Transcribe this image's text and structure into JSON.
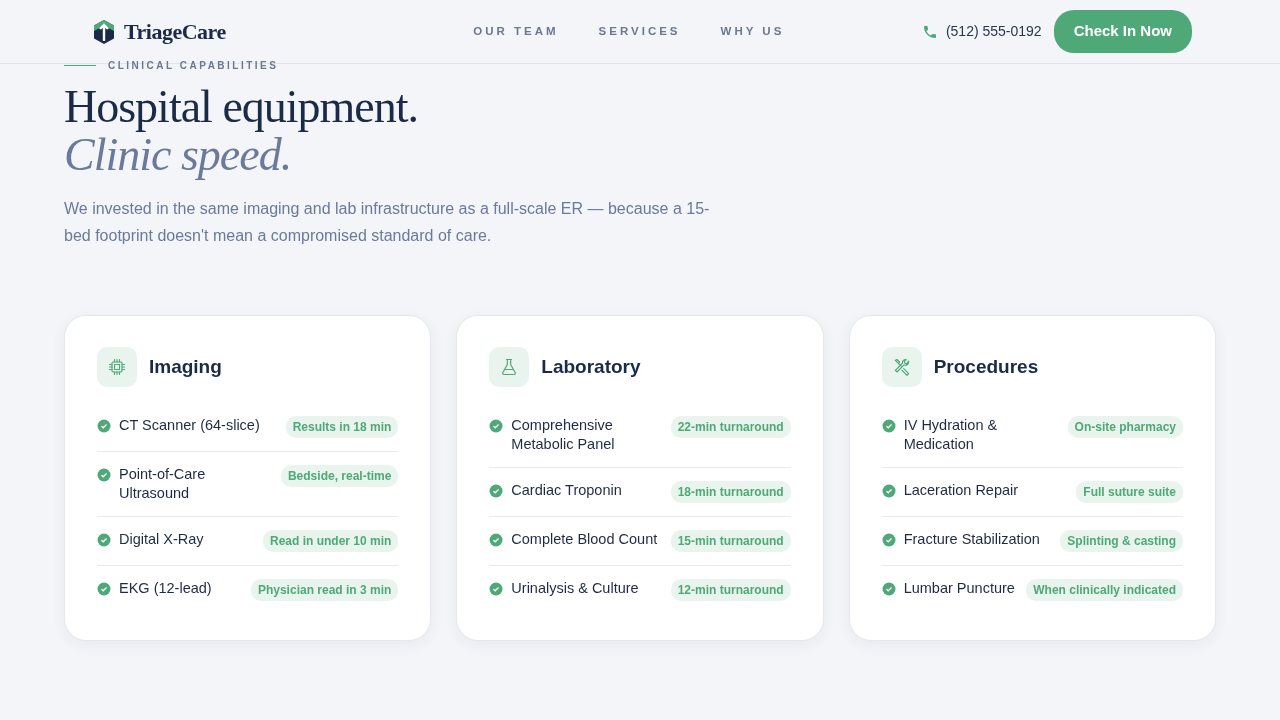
{
  "header": {
    "brand": "TriageCare",
    "nav": [
      {
        "label": "OUR TEAM"
      },
      {
        "label": "SERVICES"
      },
      {
        "label": "WHY US"
      }
    ],
    "phone": "(512) 555-0192",
    "cta": "Check In Now"
  },
  "hero": {
    "eyebrow": "CLINICAL CAPABILITIES",
    "title": "Hospital equipment.",
    "title_italic": "Clinic speed.",
    "lead": "We invested in the same imaging and lab infrastructure as a full-scale ER — because a 15-bed footprint doesn't mean a compromised standard of care."
  },
  "cards": [
    {
      "kind": "chip",
      "title": "Imaging",
      "items": [
        {
          "name": "CT Scanner (64-slice)",
          "tag": "Results in 18 min"
        },
        {
          "name": "Point-of-Care Ultrasound",
          "tag": "Bedside, real-time"
        },
        {
          "name": "Digital X-Ray",
          "tag": "Read in under 10 min"
        },
        {
          "name": "EKG (12-lead)",
          "tag": "Physician read in 3 min"
        }
      ]
    },
    {
      "kind": "flask",
      "title": "Laboratory",
      "items": [
        {
          "name": "Comprehensive Metabolic Panel",
          "tag": "22-min turnaround"
        },
        {
          "name": "Cardiac Troponin",
          "tag": "18-min turnaround"
        },
        {
          "name": "Complete Blood Count",
          "tag": "15-min turnaround"
        },
        {
          "name": "Urinalysis & Culture",
          "tag": "12-min turnaround"
        }
      ]
    },
    {
      "kind": "tools",
      "title": "Procedures",
      "items": [
        {
          "name": "IV Hydration & Medication",
          "tag": "On-site pharmacy"
        },
        {
          "name": "Laceration Repair",
          "tag": "Full suture suite"
        },
        {
          "name": "Fracture Stabilization",
          "tag": "Splinting & casting"
        },
        {
          "name": "Lumbar Puncture",
          "tag": "When clinically indicated"
        }
      ]
    }
  ]
}
